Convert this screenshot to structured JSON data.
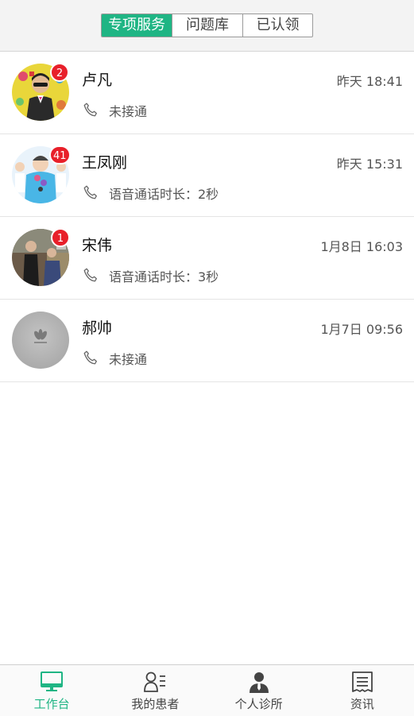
{
  "header": {
    "tabs": [
      {
        "label": "专项服务",
        "active": true
      },
      {
        "label": "问题库",
        "active": false
      },
      {
        "label": "已认领",
        "active": false
      }
    ]
  },
  "conversations": [
    {
      "name": "卢凡",
      "time": "昨天 18:41",
      "status": "未接通",
      "badge": "2",
      "icon": "phone-icon"
    },
    {
      "name": "王凤刚",
      "time": "昨天 15:31",
      "status": "语音通话时长：2秒",
      "badge": "41",
      "icon": "phone-icon"
    },
    {
      "name": "宋伟",
      "time": "1月8日 16:03",
      "status": "语音通话时长：3秒",
      "badge": "1",
      "icon": "phone-icon"
    },
    {
      "name": "郝帅",
      "time": "1月7日 09:56",
      "status": "未接通",
      "badge": "",
      "icon": "phone-icon"
    }
  ],
  "bottom_nav": [
    {
      "label": "工作台",
      "icon": "monitor-icon",
      "active": true
    },
    {
      "label": "我的患者",
      "icon": "patients-icon",
      "active": false
    },
    {
      "label": "个人诊所",
      "icon": "clinic-person-icon",
      "active": false
    },
    {
      "label": "资讯",
      "icon": "news-icon",
      "active": false
    }
  ],
  "colors": {
    "accent": "#1fb584",
    "badge": "#e8202a"
  }
}
